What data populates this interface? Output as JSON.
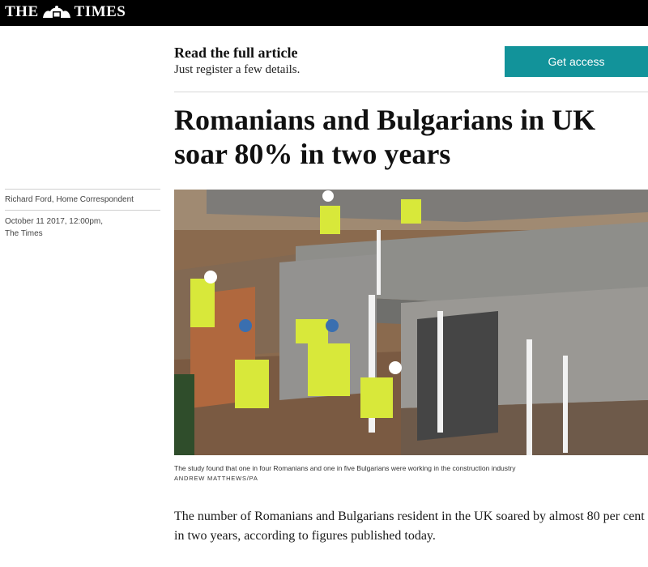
{
  "masthead": {
    "left": "THE",
    "right": "TIMES",
    "crest_icon": "royal-crest"
  },
  "register": {
    "title": "Read the full article",
    "subtitle": "Just register a few details.",
    "button_label": "Get access"
  },
  "article": {
    "headline": "Romanians and Bulgarians in UK soar 80% in two years",
    "byline": "Richard Ford, Home Correspondent",
    "date": "October 11 2017, 12:00pm,",
    "source": "The Times",
    "image_caption": "The study found that one in four Romanians and one in five Bulgarians were working in the construction industry",
    "image_credit": "ANDREW MATTHEWS/PA",
    "lead": "The number of Romanians and Bulgarians resident in the UK soared by almost 80 per cent in two years, according to figures published today."
  },
  "colors": {
    "topbar": "#000000",
    "cta": "#12939a"
  }
}
